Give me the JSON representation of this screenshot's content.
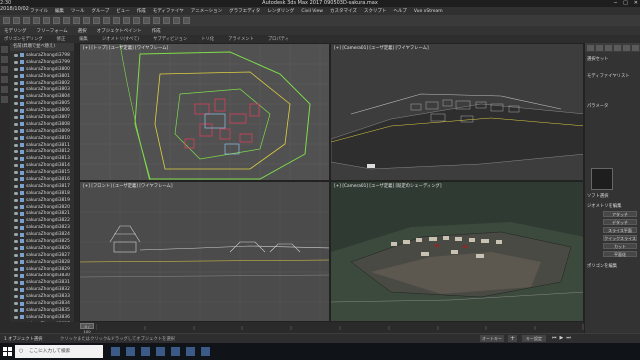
{
  "window": {
    "title": "Autodesk 3ds Max 2017    090503D-sakura.max",
    "quick_access_label": "ワークスペース: 既定"
  },
  "menubar": [
    "ファイル",
    "編集",
    "ツール",
    "グループ",
    "ビュー",
    "作成",
    "モディファイヤ",
    "アニメーション",
    "グラフエディタ",
    "レンダリング",
    "Civil View",
    "カスタマイズ",
    "スクリプト",
    "ヘルプ",
    "Vue xStream"
  ],
  "ribbon": {
    "tabs": [
      "モデリング",
      "フリーフォーム",
      "選択",
      "オブジェクトペイント",
      "作成"
    ],
    "sub": [
      "ポリゴンモデリング",
      "修正",
      "編集",
      "ジオメトリ(すべて)",
      "サブディビジョン",
      "トリ化",
      "アライメント",
      "プロパティ"
    ]
  },
  "explorer": {
    "header": "名前(昇順で並べ替え)",
    "items": [
      "sakuraZhongdi3798",
      "sakuraZhongdi3799",
      "sakuraZhongdi3800",
      "sakuraZhongdi3801",
      "sakuraZhongdi3802",
      "sakuraZhongdi3803",
      "sakuraZhongdi3804",
      "sakuraZhongdi3805",
      "sakuraZhongdi3806",
      "sakuraZhongdi3807",
      "sakuraZhongdi3808",
      "sakuraZhongdi3809",
      "sakuraZhongdi3810",
      "sakuraZhongdi3811",
      "sakuraZhongdi3812",
      "sakuraZhongdi3813",
      "sakuraZhongdi3814",
      "sakuraZhongdi3815",
      "sakuraZhongdi3816",
      "sakuraZhongdi3817",
      "sakuraZhongdi3818",
      "sakuraZhongdi3819",
      "sakuraZhongdi3820",
      "sakuraZhongdi3821",
      "sakuraZhongdi3822",
      "sakuraZhongdi3823",
      "sakuraZhongdi3824",
      "sakuraZhongdi3825",
      "sakuraZhongdi3826",
      "sakuraZhongdi3827",
      "sakuraZhongdi3828",
      "sakuraZhongdi3829",
      "sakuraZhongdi3830",
      "sakuraZhongdi3831",
      "sakuraZhongdi3832",
      "sakuraZhongdi3833",
      "sakuraZhongdi3834",
      "sakuraZhongdi3835",
      "sakuraZhongdi3836",
      "sakuraZhongdi3837"
    ],
    "footer": "ワークスペース: 既定"
  },
  "viewports": {
    "top": "[+] [トップ] [ユーザ定義] [ワイヤフレーム]",
    "cam1": "[+] [Camera01] [ユーザ定義] [ワイヤフレーム]",
    "front": "[+] [フロント] [ユーザ定義] [ワイヤフレーム]",
    "cam2": "[+] [Camera01] [ユーザ定義] [既定のシェーディング]"
  },
  "command_panel": {
    "sections": [
      "選択セット",
      "モディファイヤリスト",
      "パラメータ",
      "ソフト選択",
      "ジオメトリを編集",
      "ポリゴンを編集"
    ],
    "buttons": [
      "アタッチ",
      "デタッチ",
      "スライス平面",
      "クイックスライス",
      "カット",
      "平面化"
    ]
  },
  "timeline": {
    "frame": "0 / 100"
  },
  "status": {
    "selection": "1 オブジェクト選択",
    "hint": "クリックまたはクリック&ドラッグしてオブジェクトを選択",
    "auto_key": "オートキー",
    "set_key": "キー設定"
  },
  "taskbar": {
    "search_placeholder": "ここに入力して検索",
    "time": "2:30",
    "date": "2018/10/02"
  },
  "colors": {
    "viewport_bg": "#4a4a4a",
    "selected_blue": "#3d5a8a",
    "wire_green": "#7fdc4a",
    "wire_red": "#d8405a"
  }
}
